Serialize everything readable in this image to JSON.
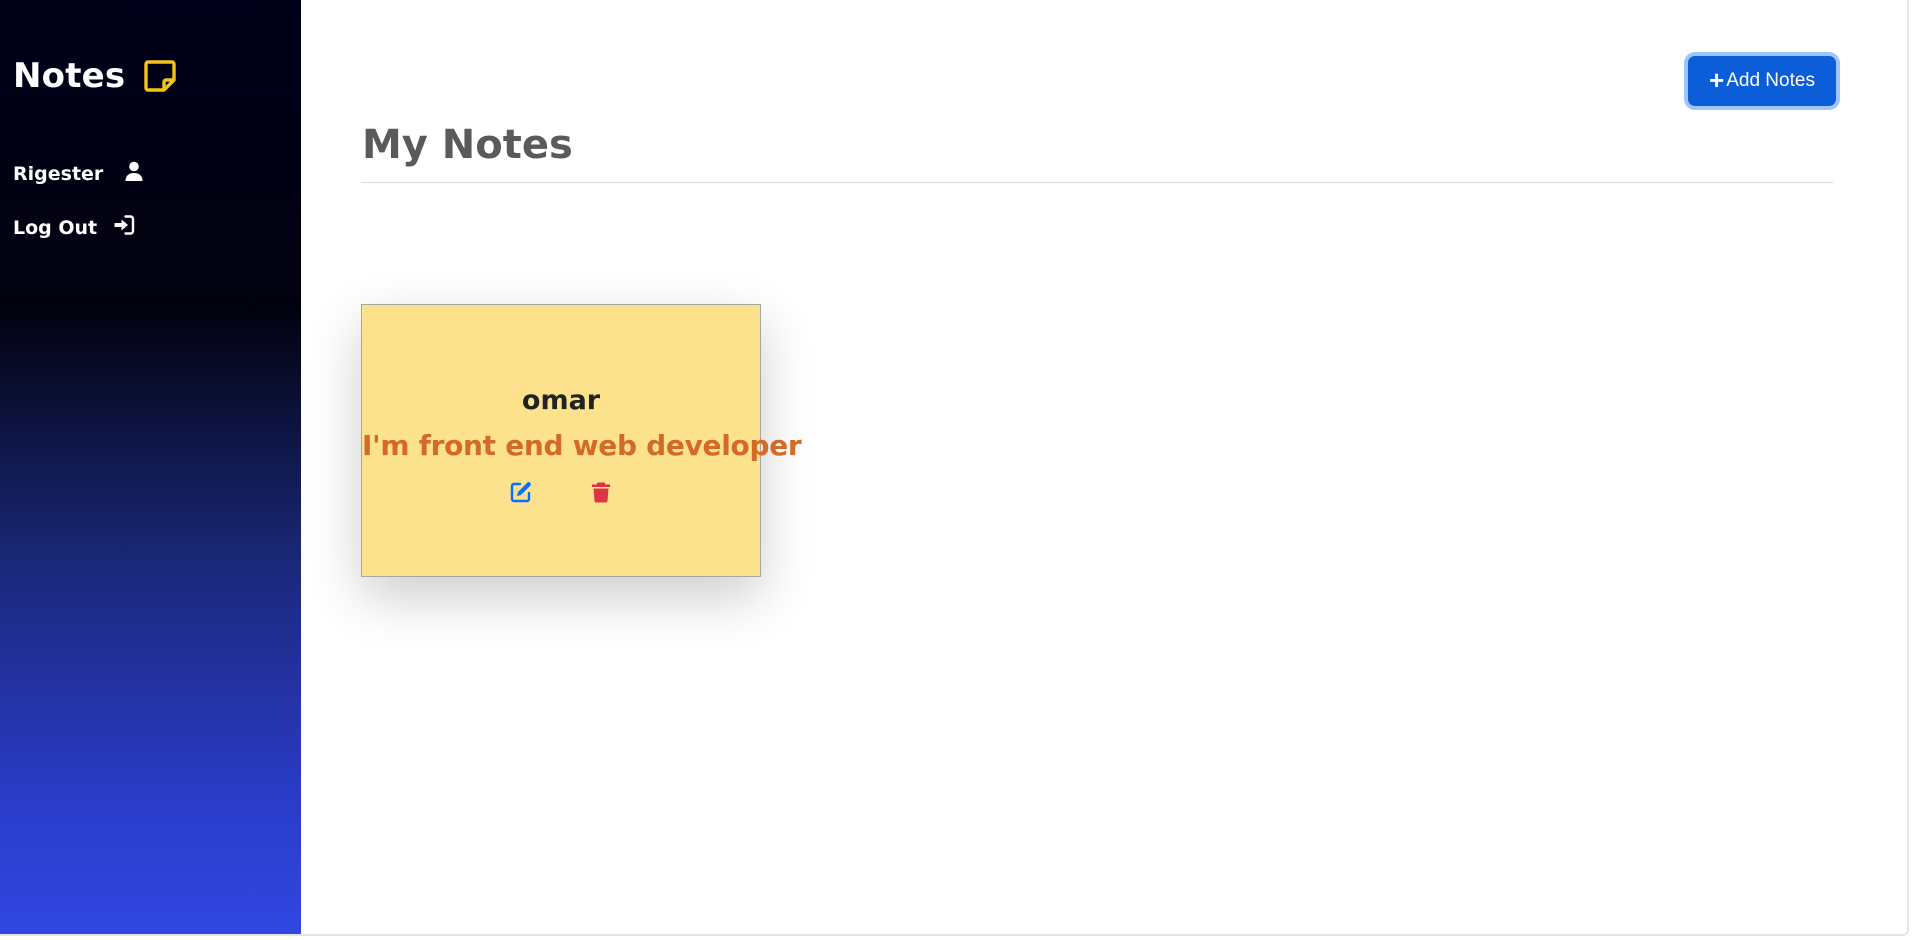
{
  "sidebar": {
    "brand": {
      "title": "Notes",
      "icon": "sticky-note-icon",
      "icon_color": "#f6c21a"
    },
    "items": [
      {
        "label": "Rigester",
        "icon": "user-icon"
      },
      {
        "label": "Log Out",
        "icon": "sign-in-icon"
      }
    ],
    "gradient": [
      "#00001a",
      "#3147e2"
    ]
  },
  "toolbar": {
    "add_label": "Add Notes",
    "add_icon": "plus-icon",
    "add_color": "#0b5ed7"
  },
  "main": {
    "title": "My Notes"
  },
  "notes": [
    {
      "title": "omar",
      "body": "I'm front end web developer",
      "background": "#fde28d",
      "edit_icon": "edit-icon",
      "delete_icon": "trash-icon",
      "edit_color": "#0d6efd",
      "delete_color": "#dc3545"
    }
  ]
}
